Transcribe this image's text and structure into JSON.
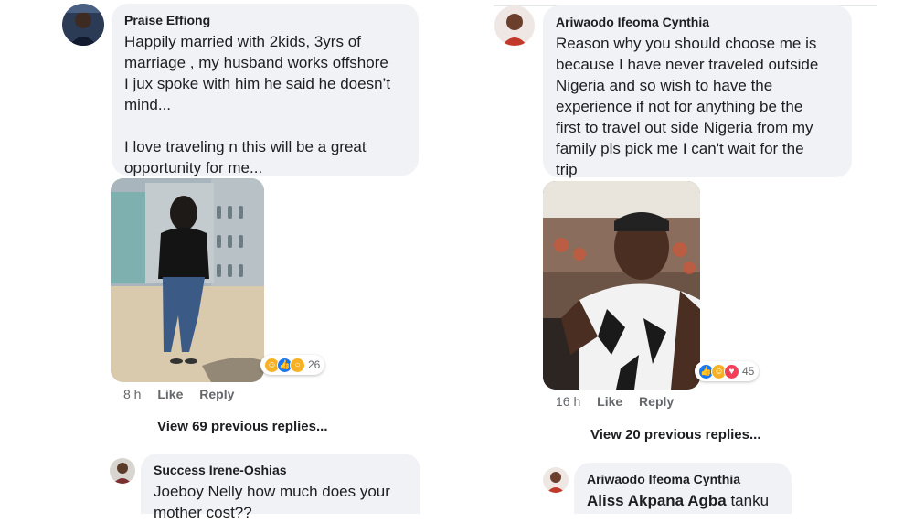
{
  "left": {
    "comment": {
      "author": "Praise Effiong",
      "text": "Happily married with 2kids, 3yrs of\nmarriage , my husband works offshore\nI jux spoke with him he said he doesn’t\nmind...\n\nI love traveling n this will be a great\nopportunity for me...",
      "reaction_count": "26",
      "time": "8 h",
      "like_label": "Like",
      "reply_label": "Reply"
    },
    "view_previous": "View 69 previous replies...",
    "reply": {
      "author": "Success Irene-Oshias",
      "text": "Joeboy Nelly how much does your\nmother cost??"
    }
  },
  "right": {
    "comment": {
      "author": "Ariwaodo Ifeoma Cynthia",
      "text": "Reason why you should choose me is\nbecause I have never traveled outside\nNigeria and so wish to have the\nexperience if not for anything be the\nfirst to travel out side Nigeria from my\nfamily pls pick me I can't wait for the\ntrip",
      "reaction_count": "45",
      "time": "16 h",
      "like_label": "Like",
      "reply_label": "Reply"
    },
    "view_previous": "View 20 previous replies...",
    "reply": {
      "author": "Ariwaodo Ifeoma Cynthia",
      "mention": "Aliss Akpana Agba",
      "text": " tanku"
    }
  },
  "colors": {
    "bubble": "#f0f2f5",
    "meta_text": "#65676b",
    "like_blue": "#1877f2",
    "love_red": "#f33e58",
    "haha_yellow": "#f7b125"
  }
}
